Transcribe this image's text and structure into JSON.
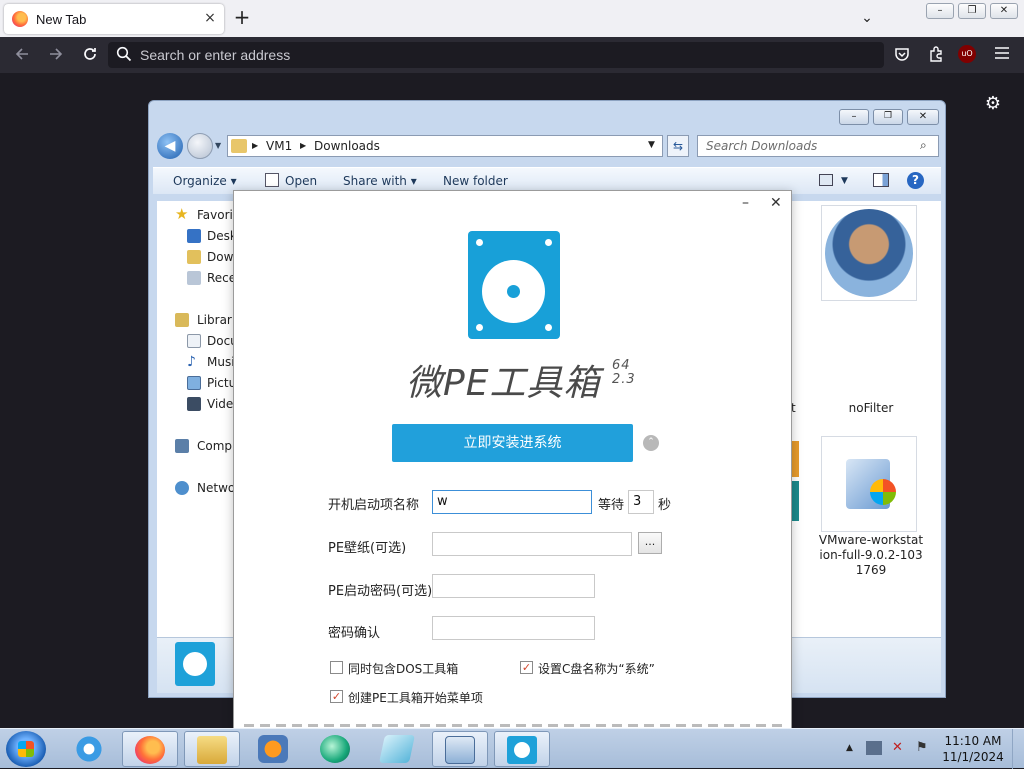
{
  "browser": {
    "tab_title": "New Tab",
    "tab_close": "×",
    "new_tab": "+",
    "list_tabs": "⌄",
    "window_buttons": [
      "–",
      "❐",
      "✕"
    ],
    "url_placeholder": "Search or enter address",
    "nav_icons": [
      "back-icon",
      "forward-icon",
      "reload-icon"
    ],
    "toolbar_icons": [
      "pocket-icon",
      "extensions-icon",
      "ublock-icon",
      "menu-icon"
    ],
    "ublock_label": "uO"
  },
  "explorer": {
    "breadcrumb": [
      "VM1",
      "Downloads"
    ],
    "search_placeholder": "Search Downloads",
    "commands": [
      "Organize ▾",
      "Open",
      "Share with ▾",
      "New folder"
    ],
    "nav_items": [
      {
        "label": "Favorit",
        "icon": "star-icon"
      },
      {
        "label": "Desk",
        "icon": "desktop-icon"
      },
      {
        "label": "Dowr",
        "icon": "downloads-icon"
      },
      {
        "label": "Rece",
        "icon": "recent-icon"
      },
      {
        "label": "Librarie",
        "icon": "libraries-icon"
      },
      {
        "label": "Docu",
        "icon": "documents-icon"
      },
      {
        "label": "Musi",
        "icon": "music-icon"
      },
      {
        "label": "Pictu",
        "icon": "pictures-icon"
      },
      {
        "label": "Video",
        "icon": "videos-icon"
      },
      {
        "label": "Compu",
        "icon": "computer-icon"
      },
      {
        "label": "Netwo",
        "icon": "network-icon"
      }
    ],
    "files": [
      {
        "name": "noFilter"
      },
      {
        "name": "VMware-workstation-full-9.0.2-1031769",
        "lines": [
          "VMware-workstat",
          "ion-full-9.0.2-103",
          "1769"
        ]
      }
    ],
    "partial_file_char": "t"
  },
  "dialog": {
    "minimize": "–",
    "close": "✕",
    "brand": "微PE工具箱",
    "brand_arch": "64",
    "brand_version": "2.3",
    "install_button": "立即安装进系统",
    "collapse_icon": "⌃",
    "boot_name_label": "开机启动项名称",
    "boot_name_value": "w",
    "wait_label": "等待",
    "wait_value": "3",
    "seconds_label": "秒",
    "wallpaper_label": "PE壁纸(可选)",
    "wallpaper_value": "",
    "browse_button": "...",
    "password_label": "PE启动密码(可选)",
    "password_value": "",
    "confirm_label": "密码确认",
    "confirm_value": "",
    "opt_dos": {
      "label": "同时包含DOS工具箱",
      "checked": false
    },
    "opt_cdrive": {
      "label": "设置C盘名称为“系统”",
      "checked": true
    },
    "opt_startmenu": {
      "label": "创建PE工具箱开始菜单项",
      "checked": true
    }
  },
  "taskbar": {
    "time": "11:10 AM",
    "date": "11/1/2024",
    "apps": [
      "ie-icon",
      "firefox-icon",
      "explorer-icon",
      "media-player-icon",
      "app-green-icon",
      "app-blue-icon",
      "network-app-icon",
      "wepe-icon"
    ]
  },
  "colors": {
    "accent": "#21a0db",
    "browser_dark": "#2b2a33"
  }
}
